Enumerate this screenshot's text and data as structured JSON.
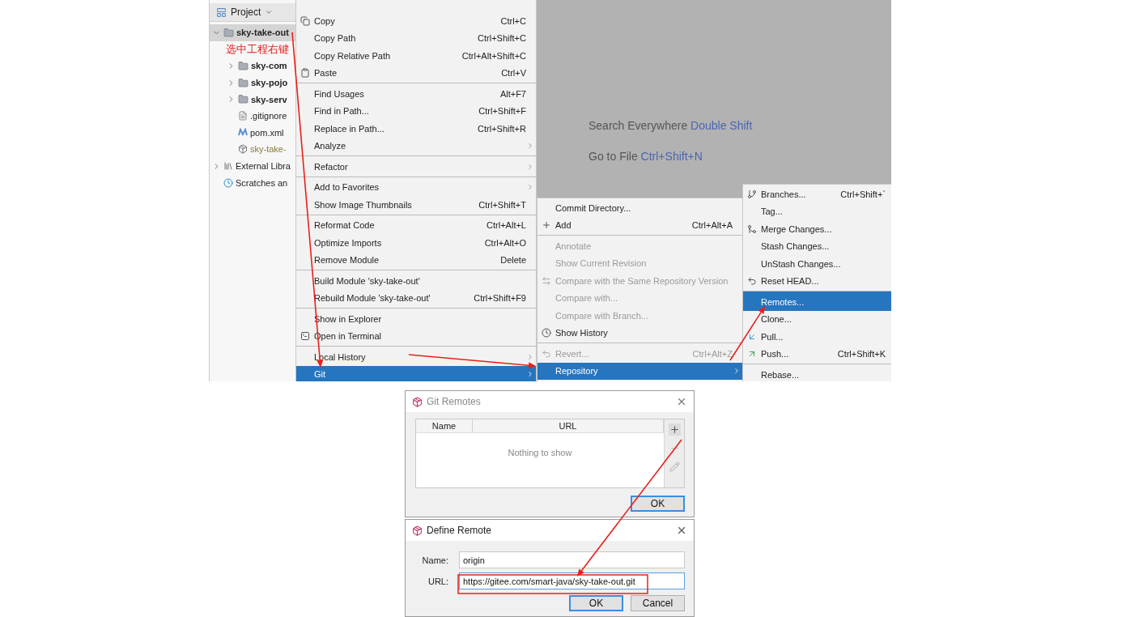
{
  "project_panel": {
    "title": "Project",
    "tree": [
      {
        "label": "sky-take-out",
        "kind": "module",
        "bold": true,
        "expanded": true,
        "selected": true,
        "children": [
          {
            "label": "sky-com",
            "kind": "module",
            "bold": true,
            "expanded": false,
            "selected": false
          },
          {
            "label": "sky-pojo",
            "kind": "module",
            "bold": true,
            "expanded": false,
            "selected": false
          },
          {
            "label": "sky-serv",
            "kind": "module",
            "bold": true,
            "expanded": false,
            "selected": false
          },
          {
            "label": ".gitignore",
            "kind": "file",
            "bold": false,
            "selected": false
          },
          {
            "label": "pom.xml",
            "kind": "maven",
            "bold": false,
            "selected": false
          },
          {
            "label": "sky-take-",
            "kind": "archive",
            "bold": false,
            "selected": false
          }
        ]
      },
      {
        "label": "External Libra",
        "kind": "library",
        "bold": false,
        "expanded": false,
        "selected": false
      },
      {
        "label": "Scratches an",
        "kind": "scratches",
        "bold": false,
        "selected": false
      }
    ]
  },
  "annotation": "选中工程右键",
  "context_menu": {
    "items": [
      {
        "label": "Copy",
        "shortcut": "Ctrl+C",
        "separator_before": false,
        "submenu": false,
        "selected": false,
        "disabled": false
      },
      {
        "label": "Copy Path",
        "shortcut": "Ctrl+Shift+C",
        "separator_before": false,
        "submenu": false,
        "selected": false,
        "disabled": false
      },
      {
        "label": "Copy Relative Path",
        "shortcut": "Ctrl+Alt+Shift+C",
        "separator_before": false,
        "submenu": false,
        "selected": false,
        "disabled": false
      },
      {
        "label": "Paste",
        "shortcut": "Ctrl+V",
        "separator_before": false,
        "submenu": false,
        "selected": false,
        "disabled": false
      },
      {
        "label": "Find Usages",
        "shortcut": "Alt+F7",
        "separator_before": true,
        "submenu": false,
        "selected": false,
        "disabled": false
      },
      {
        "label": "Find in Path...",
        "shortcut": "Ctrl+Shift+F",
        "separator_before": false,
        "submenu": false,
        "selected": false,
        "disabled": false
      },
      {
        "label": "Replace in Path...",
        "shortcut": "Ctrl+Shift+R",
        "separator_before": false,
        "submenu": false,
        "selected": false,
        "disabled": false
      },
      {
        "label": "Analyze",
        "separator_before": false,
        "submenu": true,
        "selected": false,
        "disabled": false
      },
      {
        "label": "Refactor",
        "separator_before": true,
        "submenu": true,
        "selected": false,
        "disabled": false
      },
      {
        "label": "Add to Favorites",
        "separator_before": true,
        "submenu": true,
        "selected": false,
        "disabled": false
      },
      {
        "label": "Show Image Thumbnails",
        "shortcut": "Ctrl+Shift+T",
        "separator_before": false,
        "submenu": false,
        "selected": false,
        "disabled": false
      },
      {
        "label": "Reformat Code",
        "shortcut": "Ctrl+Alt+L",
        "separator_before": true,
        "submenu": false,
        "selected": false,
        "disabled": false
      },
      {
        "label": "Optimize Imports",
        "shortcut": "Ctrl+Alt+O",
        "separator_before": false,
        "submenu": false,
        "selected": false,
        "disabled": false
      },
      {
        "label": "Remove Module",
        "shortcut": "Delete",
        "separator_before": false,
        "submenu": false,
        "selected": false,
        "disabled": false
      },
      {
        "label": "Build Module 'sky-take-out'",
        "separator_before": true,
        "submenu": false,
        "selected": false,
        "disabled": false
      },
      {
        "label": "Rebuild Module 'sky-take-out'",
        "shortcut": "Ctrl+Shift+F9",
        "separator_before": false,
        "submenu": false,
        "selected": false,
        "disabled": false
      },
      {
        "label": "Show in Explorer",
        "separator_before": true,
        "submenu": false,
        "selected": false,
        "disabled": false
      },
      {
        "label": "Open in Terminal",
        "separator_before": false,
        "submenu": false,
        "selected": false,
        "disabled": false
      },
      {
        "label": "Local History",
        "separator_before": true,
        "submenu": true,
        "selected": false,
        "disabled": false
      },
      {
        "label": "Git",
        "separator_before": false,
        "submenu": true,
        "selected": true,
        "disabled": false
      }
    ]
  },
  "editor_hints": [
    {
      "action": "Search Everywhere",
      "shortcut": "Double Shift"
    },
    {
      "action": "Go to File",
      "shortcut": "Ctrl+Shift+N"
    }
  ],
  "git_menu": {
    "items": [
      {
        "label": "Commit Directory...",
        "separator_before": false,
        "submenu": false,
        "selected": false,
        "disabled": false
      },
      {
        "label": "Add",
        "shortcut": "Ctrl+Alt+A",
        "separator_before": false,
        "submenu": false,
        "selected": false,
        "disabled": false
      },
      {
        "label": "Annotate",
        "separator_before": true,
        "submenu": false,
        "selected": false,
        "disabled": true
      },
      {
        "label": "Show Current Revision",
        "separator_before": false,
        "submenu": false,
        "selected": false,
        "disabled": true
      },
      {
        "label": "Compare with the Same Repository Version",
        "separator_before": false,
        "submenu": false,
        "selected": false,
        "disabled": true
      },
      {
        "label": "Compare with...",
        "separator_before": false,
        "submenu": false,
        "selected": false,
        "disabled": true
      },
      {
        "label": "Compare with Branch...",
        "separator_before": false,
        "submenu": false,
        "selected": false,
        "disabled": true
      },
      {
        "label": "Show History",
        "separator_before": false,
        "submenu": false,
        "selected": false,
        "disabled": false
      },
      {
        "label": "Revert...",
        "shortcut": "Ctrl+Alt+Z",
        "separator_before": true,
        "submenu": false,
        "selected": false,
        "disabled": true
      },
      {
        "label": "Repository",
        "separator_before": false,
        "submenu": true,
        "selected": true,
        "disabled": false
      }
    ]
  },
  "repository_menu": {
    "items": [
      {
        "label": "Branches...",
        "shortcut": "Ctrl+Shift+`",
        "separator_before": false,
        "submenu": false,
        "selected": false,
        "disabled": false
      },
      {
        "label": "Tag...",
        "separator_before": false,
        "submenu": false,
        "selected": false,
        "disabled": false
      },
      {
        "label": "Merge Changes...",
        "separator_before": false,
        "submenu": false,
        "selected": false,
        "disabled": false
      },
      {
        "label": "Stash Changes...",
        "separator_before": false,
        "submenu": false,
        "selected": false,
        "disabled": false
      },
      {
        "label": "UnStash Changes...",
        "separator_before": false,
        "submenu": false,
        "selected": false,
        "disabled": false
      },
      {
        "label": "Reset HEAD...",
        "separator_before": false,
        "submenu": false,
        "selected": false,
        "disabled": false
      },
      {
        "label": "Remotes...",
        "separator_before": true,
        "submenu": false,
        "selected": true,
        "disabled": false
      },
      {
        "label": "Clone...",
        "separator_before": false,
        "submenu": false,
        "selected": false,
        "disabled": false
      },
      {
        "label": "Pull...",
        "separator_before": false,
        "submenu": false,
        "selected": false,
        "disabled": false
      },
      {
        "label": "Push...",
        "shortcut": "Ctrl+Shift+K",
        "separator_before": false,
        "submenu": false,
        "selected": false,
        "disabled": false
      },
      {
        "label": "Rebase...",
        "separator_before": true,
        "submenu": false,
        "selected": false,
        "disabled": false
      }
    ]
  },
  "git_remotes_dialog": {
    "title": "Git Remotes",
    "active": false,
    "columns": [
      "Name",
      "URL"
    ],
    "empty_text": "Nothing to show",
    "toolbar": [
      {
        "disabled": false
      },
      {
        "disabled": true
      },
      {
        "disabled": true
      }
    ],
    "buttons": [
      {
        "label": "OK",
        "default": true
      }
    ]
  },
  "define_remote_dialog": {
    "title": "Define Remote",
    "active": true,
    "fields": [
      {
        "label": "Name:",
        "value": "origin",
        "focused": false
      },
      {
        "label": "URL:",
        "value": "https://gitee.com/smart-java/sky-take-out.git",
        "focused": true
      }
    ],
    "buttons": [
      {
        "label": "OK",
        "default": true
      },
      {
        "label": "Cancel",
        "default": false
      }
    ]
  }
}
